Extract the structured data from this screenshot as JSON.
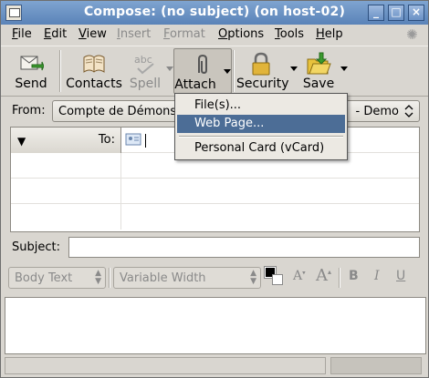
{
  "window": {
    "title": "Compose: (no subject) (on host-02)",
    "controls": [
      "_",
      "□",
      "×"
    ]
  },
  "menubar": [
    {
      "label": "File",
      "u": "F",
      "rest": "ile",
      "disabled": false
    },
    {
      "label": "Edit",
      "u": "E",
      "rest": "dit",
      "disabled": false
    },
    {
      "label": "View",
      "u": "V",
      "rest": "iew",
      "disabled": false
    },
    {
      "label": "Insert",
      "u": "I",
      "rest": "nsert",
      "disabled": true
    },
    {
      "label": "Format",
      "u": "F",
      "rest": "ormat",
      "disabled": true
    },
    {
      "label": "Options",
      "u": "O",
      "rest": "ptions",
      "disabled": false
    },
    {
      "label": "Tools",
      "u": "T",
      "rest": "ools",
      "disabled": false
    },
    {
      "label": "Help",
      "u": "H",
      "rest": "elp",
      "disabled": false
    }
  ],
  "toolbar": {
    "send": "Send",
    "contacts": "Contacts",
    "spell": "Spell",
    "attach": "Attach",
    "security": "Security",
    "save": "Save"
  },
  "from": {
    "label": "From:",
    "value": "Compte de Démons",
    "value_tail": "- Demo"
  },
  "recipients": {
    "type_label": "To:",
    "pin_glyph": "▼"
  },
  "subject": {
    "label": "Subject:",
    "value": ""
  },
  "format": {
    "paragraph": "Body Text",
    "font": "Variable Width",
    "smaller_label": "A",
    "larger_label": "A",
    "bold": "B",
    "italic": "I",
    "underline": "U"
  },
  "attach_menu": {
    "items": [
      {
        "label": "File(s)...",
        "highlighted": false
      },
      {
        "label": "Web Page...",
        "highlighted": true
      },
      {
        "label": "Personal Card (vCard)",
        "highlighted": false
      }
    ]
  },
  "colors": {
    "title_bar": "#6b91c4",
    "menu_highlight": "#4c6d96",
    "disabled_text": "#8a8a8a"
  }
}
